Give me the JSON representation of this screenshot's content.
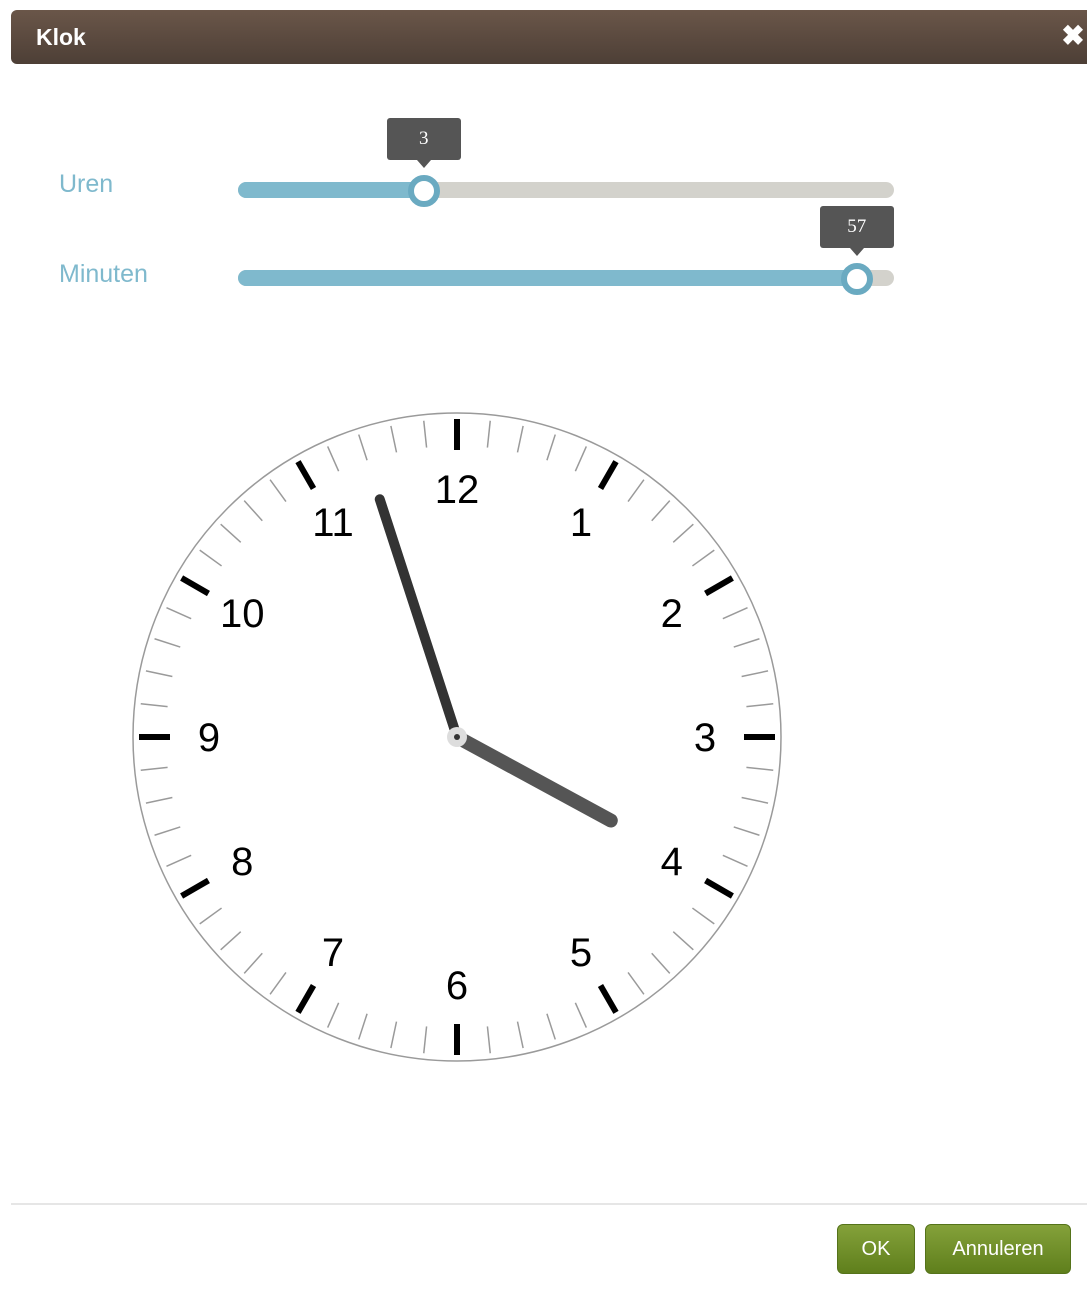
{
  "dialog": {
    "title": "Klok",
    "close_icon": "close-icon"
  },
  "sliders": {
    "hours": {
      "label": "Uren",
      "value": "3",
      "min": 0,
      "max": 11,
      "fraction": 0.272
    },
    "minutes": {
      "label": "Minuten",
      "value": "57",
      "min": 0,
      "max": 59,
      "fraction": 0.966
    }
  },
  "clock": {
    "numerals": [
      "12",
      "1",
      "2",
      "3",
      "4",
      "5",
      "6",
      "7",
      "8",
      "9",
      "10",
      "11"
    ],
    "hour": 3,
    "minute": 57
  },
  "buttons": {
    "ok_label": "OK",
    "cancel_label": "Annuleren"
  },
  "colors": {
    "titlebar": "#5e4c41",
    "slider_fill": "#7fb9cd",
    "slider_track": "#d3d2cc",
    "button": "#6f8f2a"
  }
}
